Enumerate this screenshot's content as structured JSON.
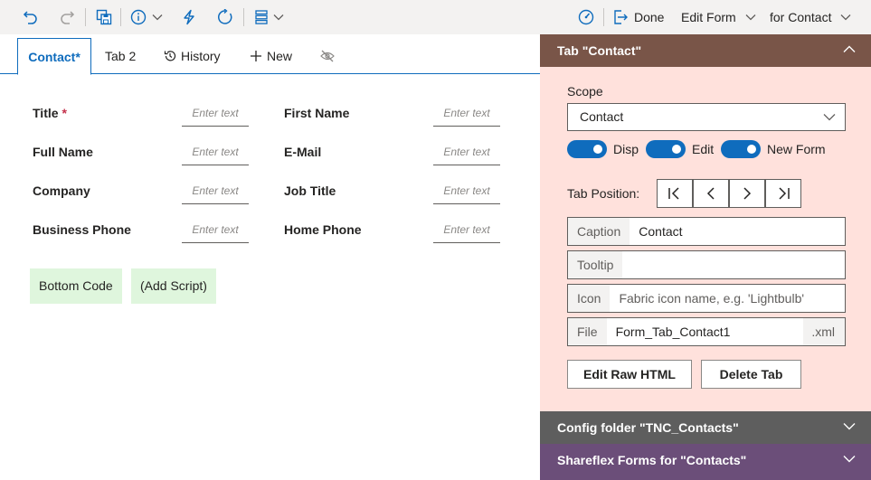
{
  "toolbar": {
    "icons": [
      "undo-icon",
      "redo-icon",
      "save-icon",
      "info-icon",
      "flash-icon",
      "refresh-icon",
      "layout-icon",
      "speedometer-icon",
      "exit-icon"
    ],
    "done_label": "Done",
    "edit_form_label": "Edit Form",
    "for_contact_label": "for Contact"
  },
  "tabs": [
    {
      "label": "Contact*",
      "active": true
    },
    {
      "label": "Tab 2"
    },
    {
      "label": "History",
      "icon": "history-icon"
    },
    {
      "label": "New",
      "icon": "plus-icon"
    },
    {
      "label": "",
      "icon": "hidden-icon"
    }
  ],
  "form": {
    "placeholder": "Enter text",
    "fields": [
      {
        "label": "Title",
        "required_mark": "*"
      },
      {
        "label": "First Name"
      },
      {
        "label": "Full Name"
      },
      {
        "label": "E-Mail"
      },
      {
        "label": "Company"
      },
      {
        "label": "Job Title"
      },
      {
        "label": "Business Phone"
      },
      {
        "label": "Home Phone"
      }
    ],
    "bottom_code_label": "Bottom Code",
    "add_script_label": "(Add Script)"
  },
  "panel": {
    "header_title": "Tab \"Contact\"",
    "scope_label": "Scope",
    "scope_value": "Contact",
    "toggles": [
      {
        "label": "Disp",
        "on": true
      },
      {
        "label": "Edit",
        "on": true
      },
      {
        "label": "New Form",
        "on": true
      }
    ],
    "tab_position_label": "Tab Position:",
    "caption_label": "Caption",
    "caption_value": "Contact",
    "tooltip_label": "Tooltip",
    "tooltip_value": "",
    "icon_label": "Icon",
    "icon_placeholder": "Fabric icon name, e.g. 'Lightbulb'",
    "file_label": "File",
    "file_value": "Form_Tab_Contact1",
    "file_suffix": ".xml",
    "edit_raw_html_label": "Edit Raw HTML",
    "delete_tab_label": "Delete Tab",
    "config_header": "Config folder \"TNC_Contacts\"",
    "shareflex_header": "Shareflex Forms for \"Contacts\""
  },
  "colors": {
    "accent": "#0f6cbd",
    "panel_bg": "#ffe1dc",
    "panel_header": "#795548",
    "config_header": "#5e5e5e",
    "shareflex_header": "#6b4e79",
    "code_button_bg": "#dff6dd",
    "required": "#c4314b"
  }
}
